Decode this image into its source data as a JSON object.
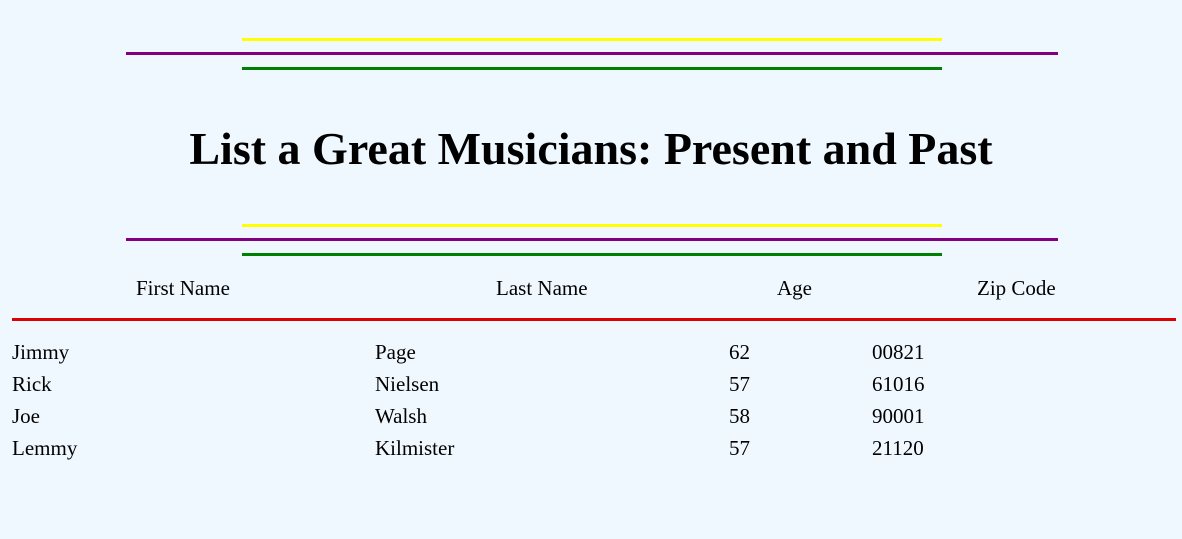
{
  "page": {
    "title": "List a Great Musicians: Present and Past"
  },
  "colors": {
    "background": "#f0f8ff",
    "rule_yellow": "#ffff00",
    "rule_purple": "#800080",
    "rule_green": "#008000",
    "rule_red": "#dd0000"
  },
  "table": {
    "headers": [
      "First Name",
      "Last Name",
      "Age",
      "Zip Code"
    ],
    "rows": [
      {
        "first": "Jimmy",
        "last": "Page",
        "age": "62",
        "zip": "00821"
      },
      {
        "first": "Rick",
        "last": "Nielsen",
        "age": "57",
        "zip": "61016"
      },
      {
        "first": "Joe",
        "last": "Walsh",
        "age": "58",
        "zip": "90001"
      },
      {
        "first": "Lemmy",
        "last": "Kilmister",
        "age": "57",
        "zip": "21120"
      }
    ]
  }
}
